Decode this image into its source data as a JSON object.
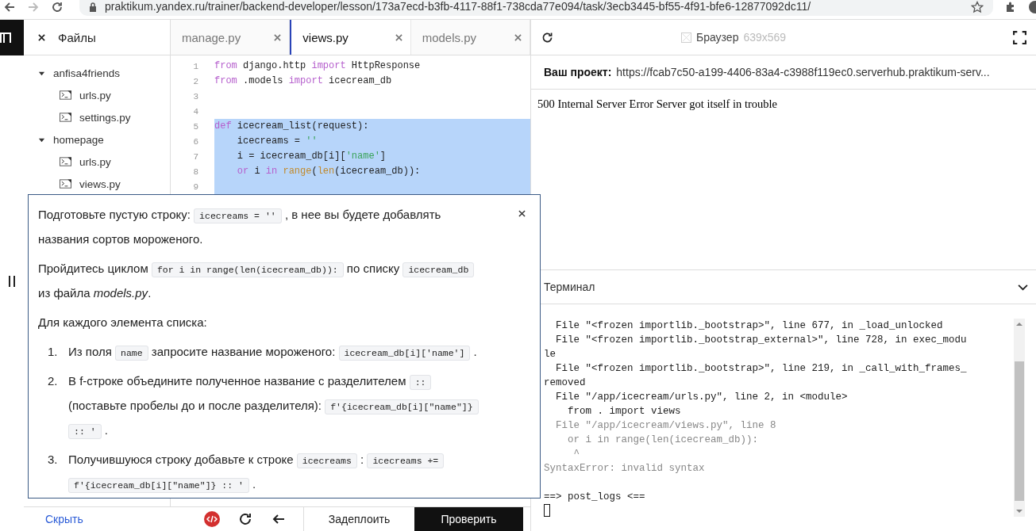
{
  "browser": {
    "url": "praktikum.yandex.ru/trainer/backend-developer/lesson/173a7ecd-b3fb-4117-88f1-738cda77e094/task/3ecb3445-bf55-4f91-bfe6-12877092dc11/"
  },
  "files_panel": {
    "title": "Файлы",
    "tree": [
      {
        "name": "anfisa4friends",
        "kind": "folder",
        "expanded": true,
        "children": [
          {
            "name": "urls.py",
            "kind": "file"
          },
          {
            "name": "settings.py",
            "kind": "file"
          }
        ]
      },
      {
        "name": "homepage",
        "kind": "folder",
        "expanded": true,
        "children": [
          {
            "name": "urls.py",
            "kind": "file"
          },
          {
            "name": "views.py",
            "kind": "file"
          }
        ]
      }
    ]
  },
  "editor": {
    "tabs": [
      {
        "label": "manage.py",
        "selected": false
      },
      {
        "label": "views.py",
        "selected": true
      },
      {
        "label": "models.py",
        "selected": false
      }
    ],
    "lines": [
      {
        "number": "1",
        "selected": false,
        "tokens": [
          {
            "kind": "keyword",
            "text": "from"
          },
          {
            "kind": "plain",
            "text": " django.http "
          },
          {
            "kind": "keyword",
            "text": "import"
          },
          {
            "kind": "plain",
            "text": " HttpResponse"
          }
        ]
      },
      {
        "number": "2",
        "selected": false,
        "tokens": [
          {
            "kind": "keyword",
            "text": "from"
          },
          {
            "kind": "plain",
            "text": " .models "
          },
          {
            "kind": "keyword",
            "text": "import"
          },
          {
            "kind": "plain",
            "text": " icecream_db"
          }
        ]
      },
      {
        "number": "3",
        "selected": false
      },
      {
        "number": "4",
        "selected": false
      },
      {
        "number": "5",
        "selected": true,
        "tokens": [
          {
            "kind": "keyword",
            "text": "def"
          },
          {
            "kind": "plain",
            "text": " icecream_list(request):"
          }
        ]
      },
      {
        "number": "6",
        "selected": true,
        "tokens": [
          {
            "kind": "plain",
            "text": "    icecreams = "
          },
          {
            "kind": "string",
            "text": "''"
          }
        ]
      },
      {
        "number": "7",
        "selected": true,
        "tokens": [
          {
            "kind": "plain",
            "text": "    i = icecream_db[i]["
          },
          {
            "kind": "string",
            "text": "'name'"
          },
          {
            "kind": "plain",
            "text": "]"
          }
        ]
      },
      {
        "number": "8",
        "selected": true,
        "tokens": [
          {
            "kind": "keyword",
            "text": "    or"
          },
          {
            "kind": "plain",
            "text": " i "
          },
          {
            "kind": "keyword",
            "text": "in "
          },
          {
            "kind": "builtin",
            "text": "range"
          },
          {
            "kind": "plain",
            "text": "("
          },
          {
            "kind": "builtin",
            "text": "len"
          },
          {
            "kind": "plain",
            "text": "(icecream_db)):"
          }
        ]
      },
      {
        "number": "9",
        "selected": true
      }
    ]
  },
  "task_popup": {
    "paragraphs": [
      {
        "segments": [
          {
            "kind": "text",
            "text": "Подготовьте пустую строку: "
          },
          {
            "kind": "code",
            "text": "icecreams = ''"
          },
          {
            "kind": "text",
            "text": " , в нее вы будете добавлять названия сортов мороженого."
          }
        ]
      },
      {
        "segments": [
          {
            "kind": "text",
            "text": "Пройдитесь циклом "
          },
          {
            "kind": "code",
            "text": "for i in range(len(icecream_db)):"
          },
          {
            "kind": "text",
            "text": " по списку "
          },
          {
            "kind": "code",
            "text": "icecream_db"
          },
          {
            "kind": "text",
            "text": " из файла *models.py*."
          }
        ]
      },
      {
        "segments": [
          {
            "kind": "text",
            "text": "Для каждого элемента списка:"
          }
        ]
      }
    ],
    "steps": [
      {
        "number": "1.",
        "segments": [
          {
            "kind": "text",
            "text": "Из поля "
          },
          {
            "kind": "code",
            "text": "name"
          },
          {
            "kind": "text",
            "text": " запросите название мороженого: "
          },
          {
            "kind": "code",
            "text": "icecream_db[i]['name']"
          },
          {
            "kind": "text",
            "text": " ."
          }
        ]
      },
      {
        "number": "2.",
        "segments": [
          {
            "kind": "text",
            "text": "В f-строке объедините полученное название с разделителем "
          },
          {
            "kind": "code",
            "text": "::"
          },
          {
            "kind": "text",
            "text": " (поставьте пробелы до и после разделителя): "
          },
          {
            "kind": "code",
            "text": "f'{icecream_db[i][\"name\"]} :: '"
          },
          {
            "kind": "text",
            "text": " ."
          }
        ]
      },
      {
        "number": "3.",
        "segments": [
          {
            "kind": "text",
            "text": "Получившуюся строку добавьте к строке "
          },
          {
            "kind": "code",
            "text": "icecreams"
          },
          {
            "kind": "text",
            "text": " : "
          },
          {
            "kind": "code",
            "text": "icecreams += f'{icecream_db[i][\"name\"]} :: '"
          },
          {
            "kind": "text",
            "text": " ."
          }
        ]
      }
    ]
  },
  "bottom_bar": {
    "hide_link": "Скрыть",
    "deploy_button": "Задеплоить",
    "check_button": "Проверить"
  },
  "preview": {
    "title": "Браузер",
    "size": "639x569",
    "project_label": "Ваш проект:",
    "project_url": "https://fcab7c50-a199-4406-83a4-c3988f119ec0.serverhub.praktikum-serv...",
    "page_text": "500 Internal Server Error Server got itself in trouble"
  },
  "terminal": {
    "title": "Терминал",
    "lines": [
      {
        "text": "  File \"<frozen importlib._bootstrap>\", line 677, in _load_unlocked",
        "dim": false
      },
      {
        "text": "  File \"<frozen importlib._bootstrap_external>\", line 728, in exec_modu",
        "dim": false
      },
      {
        "text": "le",
        "dim": false
      },
      {
        "text": "  File \"<frozen importlib._bootstrap>\", line 219, in _call_with_frames_",
        "dim": false
      },
      {
        "text": "removed",
        "dim": false
      },
      {
        "text": "  File \"/app/icecream/urls.py\", line 2, in <module>",
        "dim": false
      },
      {
        "text": "    from . import views",
        "dim": false
      },
      {
        "text": "  File \"/app/icecream/views.py\", line 8",
        "dim": true
      },
      {
        "text": "    or i in range(len(icecream_db)):",
        "dim": true
      },
      {
        "text": "     ^",
        "dim": true
      },
      {
        "text": "SyntaxError: invalid syntax",
        "dim": true
      },
      {
        "text": "==> post_logs <==",
        "dim": false,
        "kind": "marker"
      }
    ]
  }
}
